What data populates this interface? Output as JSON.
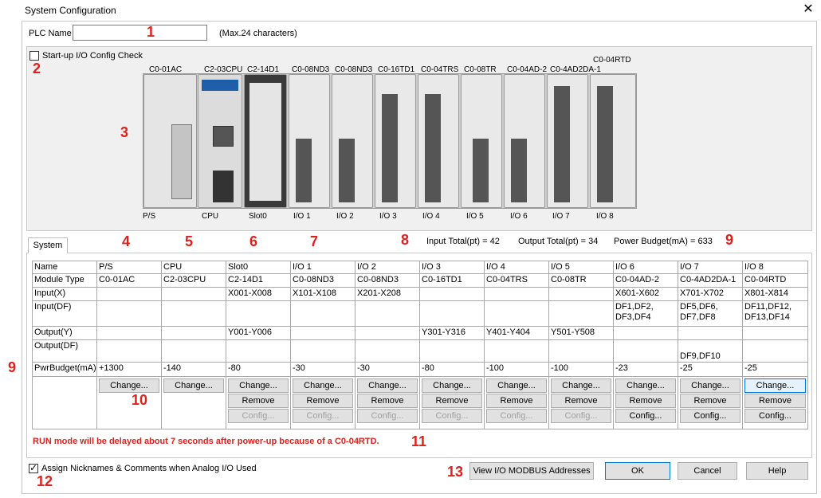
{
  "window": {
    "title": "System Configuration"
  },
  "plc": {
    "label": "PLC Name",
    "value": "",
    "hint": "(Max.24 characters)"
  },
  "startup_check": {
    "label": "Start-up I/O Config Check",
    "checked": false
  },
  "rack": {
    "modules": [
      {
        "name": "C0-01AC",
        "slot": "P/S"
      },
      {
        "name": "C2-03CPU",
        "slot": "CPU"
      },
      {
        "name": "C2-14D1",
        "slot": "Slot0"
      },
      {
        "name": "C0-08ND3",
        "slot": "I/O 1"
      },
      {
        "name": "C0-08ND3",
        "slot": "I/O 2"
      },
      {
        "name": "C0-16TD1",
        "slot": "I/O 3"
      },
      {
        "name": "C0-04TRS",
        "slot": "I/O 4"
      },
      {
        "name": "C0-08TR",
        "slot": "I/O 5"
      },
      {
        "name": "C0-04AD-2",
        "slot": "I/O 6"
      },
      {
        "name": "C0-4AD2DA-1",
        "slot": "I/O 7"
      },
      {
        "name": "C0-04RTD",
        "slot": "I/O 8"
      }
    ]
  },
  "tab": {
    "label": "System"
  },
  "totals": {
    "input": "Input Total(pt) = 42",
    "output": "Output Total(pt) = 34",
    "power": "Power Budget(mA) = 633"
  },
  "table": {
    "headers": [
      "Name",
      "P/S",
      "CPU",
      "Slot0",
      "I/O 1",
      "I/O 2",
      "I/O 3",
      "I/O 4",
      "I/O 5",
      "I/O 6",
      "I/O 7",
      "I/O 8"
    ],
    "rows": [
      {
        "label": "Module Type",
        "cells": [
          "C0-01AC",
          "C2-03CPU",
          "C2-14D1",
          "C0-08ND3",
          "C0-08ND3",
          "C0-16TD1",
          "C0-04TRS",
          "C0-08TR",
          "C0-04AD-2",
          "C0-4AD2DA-1",
          "C0-04RTD"
        ]
      },
      {
        "label": "Input(X)",
        "cells": [
          "",
          "",
          "X001-X008",
          "X101-X108",
          "X201-X208",
          "",
          "",
          "",
          "X601-X602",
          "X701-X702",
          "X801-X814"
        ]
      },
      {
        "label": "Input(DF)",
        "cells": [
          "",
          "",
          "",
          "",
          "",
          "",
          "",
          "",
          "DF1,DF2, DF3,DF4",
          "DF5,DF6, DF7,DF8",
          "DF11,DF12, DF13,DF14"
        ]
      },
      {
        "label": "Output(Y)",
        "cells": [
          "",
          "",
          "Y001-Y006",
          "",
          "",
          "Y301-Y316",
          "Y401-Y404",
          "Y501-Y508",
          "",
          "",
          ""
        ]
      },
      {
        "label": "Output(DF)",
        "cells": [
          "",
          "",
          "",
          "",
          "",
          "",
          "",
          "",
          "",
          "DF9,DF10",
          ""
        ]
      },
      {
        "label": "PwrBudget(mA)",
        "cells": [
          "+1300",
          "-140",
          "-80",
          "-30",
          "-30",
          "-80",
          "-100",
          "-100",
          "-23",
          "-25",
          "-25"
        ]
      }
    ],
    "change_label": "Change...",
    "remove_label": "Remove",
    "config_label": "Config..."
  },
  "warning": "RUN mode will be delayed about 7 seconds after power-up because of a C0-04RTD.",
  "assign": {
    "label": "Assign Nicknames & Comments when Analog I/O Used",
    "checked": true
  },
  "buttons": {
    "modbus": "View I/O MODBUS Addresses",
    "ok": "OK",
    "cancel": "Cancel",
    "help": "Help"
  },
  "callouts": [
    "1",
    "2",
    "3",
    "4",
    "5",
    "6",
    "7",
    "8",
    "9",
    "9",
    "10",
    "11",
    "12",
    "13"
  ],
  "colors": {
    "callout": "#e0201b",
    "warning": "#e0201b",
    "focus": "#0078d7"
  }
}
